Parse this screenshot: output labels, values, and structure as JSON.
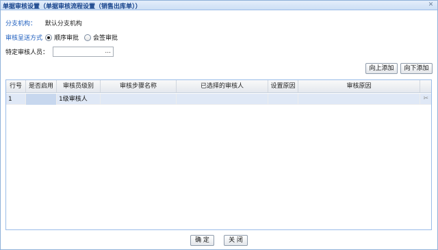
{
  "window": {
    "title": "单据审核设置（单据审核流程设置（销售出库单））",
    "close_icon": "close-icon"
  },
  "branch": {
    "label": "分支机构：",
    "value": "默认分支机构"
  },
  "send_mode": {
    "label": "审核呈送方式",
    "options": [
      "顺序审批",
      "会签审批"
    ],
    "selected": "顺序审批"
  },
  "reviewer": {
    "label": "特定审核人员：",
    "value": "",
    "picker_glyph": "..."
  },
  "toolbar": {
    "add_up": "向上添加",
    "add_down": "向下添加"
  },
  "table": {
    "columns": [
      "行号",
      "是否启用",
      "审核员级别",
      "审核步骤名称",
      "已选择的审核人",
      "设置原因",
      "审核原因"
    ],
    "rows": [
      [
        "1",
        "",
        "1级审核人",
        "",
        "",
        "",
        ""
      ]
    ]
  },
  "footer": {
    "ok": "确 定",
    "close": "关 闭"
  },
  "colors": {
    "accent": "#15428b",
    "label_blue": "#1f5fbf",
    "selected_row": "#dfe8f6"
  }
}
